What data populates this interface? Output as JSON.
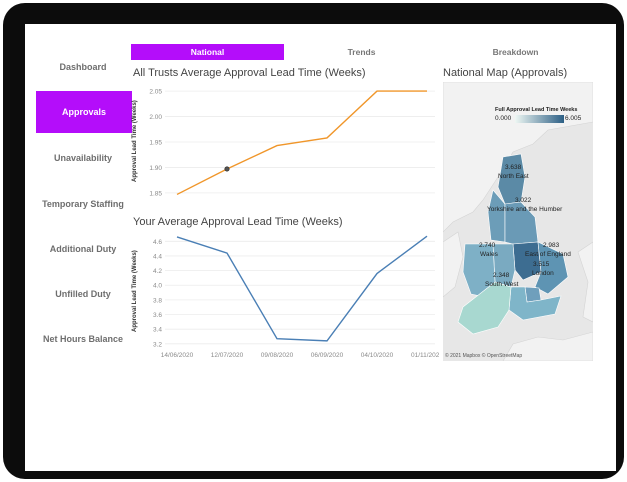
{
  "nav": {
    "items": [
      {
        "label": "Dashboard"
      },
      {
        "label": "Approvals"
      },
      {
        "label": "Unavailability"
      },
      {
        "label": "Temporary Staffing"
      },
      {
        "label": "Additional Duty"
      },
      {
        "label": "Unfilled Duty"
      },
      {
        "label": "Net Hours Balance"
      }
    ],
    "active": "Approvals"
  },
  "tabs": [
    {
      "label": "National",
      "active": true
    },
    {
      "label": "Trends",
      "active": false
    },
    {
      "label": "Breakdown",
      "active": false
    }
  ],
  "colors": {
    "accent": "#b40dfa",
    "line_top": "#f0962a",
    "line_bottom": "#4a7fb5"
  },
  "chart_data": [
    {
      "type": "line",
      "title": "All Trusts Average Approval Lead Time (Weeks)",
      "ylabel": "Approval Lead Time (Weeks)",
      "yticks": [
        "1.85",
        "1.90",
        "1.95",
        "2.00",
        "2.05"
      ],
      "ylim": [
        1.84,
        2.06
      ],
      "x": [
        "14/06/2020",
        "12/07/2020",
        "09/08/2020",
        "06/09/2020",
        "04/10/2020",
        "01/11/2020"
      ],
      "values": [
        1.847,
        1.897,
        1.943,
        1.958,
        2.05,
        2.05
      ],
      "highlight_index": 1,
      "grid": true
    },
    {
      "type": "line",
      "title": "Your Average Approval Lead Time (Weeks)",
      "ylabel": "Approval Lead Time (Weeks)",
      "yticks": [
        "3.2",
        "3.4",
        "3.6",
        "3.8",
        "4.0",
        "4.2",
        "4.4",
        "4.6"
      ],
      "ylim": [
        3.17,
        4.7
      ],
      "x": [
        "14/06/2020",
        "12/07/2020",
        "09/08/2020",
        "06/09/2020",
        "04/10/2020",
        "01/11/2020"
      ],
      "xticks": [
        "14/06/2020",
        "12/07/2020",
        "09/08/2020",
        "06/09/2020",
        "04/10/2020",
        "01/11/2020"
      ],
      "values": [
        4.66,
        4.44,
        3.27,
        3.24,
        4.16,
        4.67
      ],
      "grid": true
    }
  ],
  "map": {
    "title": "National Map (Approvals)",
    "legend_title": "Full Approval Lead Time Weeks",
    "legend_min": "0.000",
    "legend_max": "6.005",
    "regions": [
      {
        "name": "North East",
        "value": "3.638"
      },
      {
        "name": "Yorkshire and the Humber",
        "value": "3.022"
      },
      {
        "name": "Wales",
        "value": "2.740"
      },
      {
        "name": "East of England",
        "value": "2.983"
      },
      {
        "name": "London",
        "value": "3.515"
      },
      {
        "name": "South West",
        "value": "2.348"
      }
    ],
    "copyright": "© 2021 Mapbox © OpenStreetMap"
  }
}
